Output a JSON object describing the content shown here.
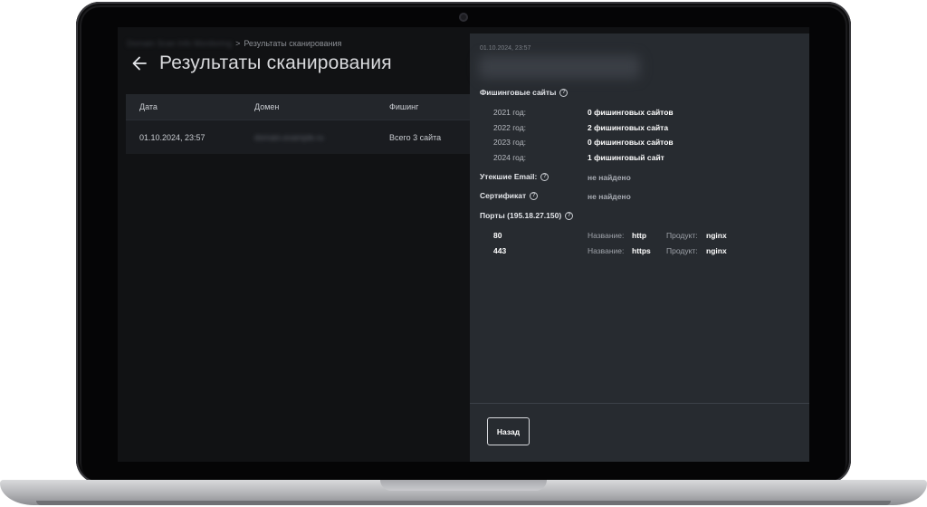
{
  "breadcrumb": {
    "parent": "Domain Scan Info Monitoring",
    "separator": ">",
    "current": "Результаты сканирования"
  },
  "page_title": "Результаты сканирования",
  "table": {
    "headers": [
      "Дата",
      "Домен",
      "Фишинг"
    ],
    "rows": [
      {
        "date": "01.10.2024, 23:57",
        "domain": "domain.example.ru",
        "phishing": "Всего 3 сайта"
      }
    ]
  },
  "panel": {
    "date": "01.10.2024, 23:57",
    "phishing_sites": {
      "label": "Фишинговые сайты",
      "years": [
        {
          "year": "2021 год:",
          "value": "0 фишинговых сайтов"
        },
        {
          "year": "2022 год:",
          "value": "2 фишинговых сайта"
        },
        {
          "year": "2023 год:",
          "value": "0 фишинговых сайтов"
        },
        {
          "year": "2024 год:",
          "value": "1 фишинговый сайт"
        }
      ]
    },
    "leaked_email": {
      "label": "Утекшие Email:",
      "value": "не найдено"
    },
    "certificate": {
      "label": "Сертификат",
      "value": "не найдено"
    },
    "ports": {
      "label": "Порты (195.18.27.150)",
      "name_label": "Название:",
      "product_label": "Продукт:",
      "items": [
        {
          "port": "80",
          "name": "http",
          "product": "nginx"
        },
        {
          "port": "443",
          "name": "https",
          "product": "nginx"
        }
      ]
    },
    "back_button": "Назад"
  }
}
